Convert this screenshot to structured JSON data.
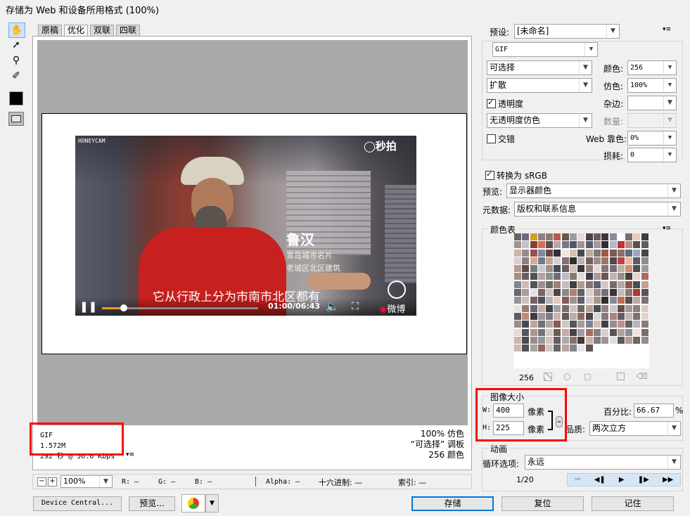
{
  "window": {
    "title": "存储为 Web 和设备所用格式 (100%)"
  },
  "tabs": [
    {
      "label": "原稿"
    },
    {
      "label": "优化"
    },
    {
      "label": "双联"
    },
    {
      "label": "四联"
    }
  ],
  "tools": [
    "hand-icon",
    "slice-select-icon",
    "zoom-icon",
    "eyedropper-icon",
    "eyedropper-color-swatch",
    "toggle-slices-icon"
  ],
  "video": {
    "watermark_left": "HONEYCAM",
    "watermark_right": "秒拍",
    "name": "鲁汉",
    "caption_small_1": "青岛城市名片",
    "caption_small_2": "老城区北区建筑",
    "subtitle": "它从行政上分为市南市北区都有",
    "time": "01:00/06:43",
    "weibo": "微博",
    "progress_fraction": 0.14
  },
  "info_left": {
    "format": "GIF",
    "size": "1.572M",
    "time": "292 秒 @ 56.6 Kbps"
  },
  "info_right": {
    "line1": "100% 仿色",
    "line2": "“可选择” 调板",
    "line3": "256 颜色"
  },
  "status_bar": {
    "zoom": "100%",
    "r_label": "R:",
    "r_val": "—",
    "g_label": "G:",
    "g_val": "—",
    "b_label": "B:",
    "b_val": "—",
    "alpha_label": "Alpha:",
    "alpha_val": "—",
    "hex_label": "十六进制:",
    "hex_val": "—",
    "index_label": "索引:",
    "index_val": "—"
  },
  "bottom_buttons": {
    "device_central": "Device Central...",
    "preview": "预览...",
    "save": "存储",
    "reset": "复位",
    "remember": "记住"
  },
  "settings": {
    "preset_label": "预设:",
    "preset_value": "[未命名]",
    "format": "GIF",
    "reduction": "可选择",
    "colors_label": "颜色:",
    "colors_value": "256",
    "dither_algo": "扩散",
    "dither_label": "仿色:",
    "dither_value": "100%",
    "transparency_label": "透明度",
    "transparency_checked": true,
    "matte_label": "杂边:",
    "matte_value": "",
    "trans_dither": "无透明度仿色",
    "amount_label": "数量:",
    "amount_value": "",
    "interlaced_label": "交错",
    "interlaced_checked": false,
    "websnap_label": "Web 靠色:",
    "websnap_value": "0%",
    "lossy_label": "损耗:",
    "lossy_value": "0",
    "srgb_label": "转换为 sRGB",
    "srgb_checked": true,
    "preview_label": "预览:",
    "preview_value": "显示器颜色",
    "metadata_label": "元数据:",
    "metadata_value": "版权和联系信息"
  },
  "color_table": {
    "title": "颜色表",
    "count": "256",
    "colors": [
      "#6b6366",
      "#6e6a7c",
      "#cfa028",
      "#8e7f84",
      "#8d7a7a",
      "#b85b4d",
      "#5f5a52",
      "#a29aa1",
      "#e6d9d6",
      "#494246",
      "#6e5b58",
      "#3a3a3c",
      "#8d8a9c",
      "#ffffff",
      "#7b6b6a",
      "#e8cdb9",
      "#3e3c3f",
      "#a1948a",
      "#c5c0c4",
      "#8a3f35",
      "#d96a55",
      "#5c4d4b",
      "#b5a8aa",
      "#757a86",
      "#4f5868",
      "#a69292",
      "#585a6f",
      "#a99799",
      "#2d2c34",
      "#b3b9c8",
      "#cc2f2f",
      "#b88f81",
      "#5a4f56",
      "#5a605a",
      "#c9b5a7",
      "#928e90",
      "#9a5048",
      "#7a8ca0",
      "#6e4944",
      "#323035",
      "#efe5e1",
      "#d8c0b0",
      "#49474f",
      "#bca9a0",
      "#7c7a74",
      "#a3564b",
      "#7b5950",
      "#8e6e66",
      "#5b6b86",
      "#a5a5b8",
      "#4c4444",
      "#d8cfd2",
      "#8c807c",
      "#e0a58f",
      "#6e7a92",
      "#c6a494",
      "#d4d0d4",
      "#8a6c75",
      "#2e2f2a",
      "#bfb3b5",
      "#6f625f",
      "#9f8d85",
      "#a07366",
      "#4c494b",
      "#c3403c",
      "#e9b8a0",
      "#5c5a62",
      "#8a8e8a",
      "#b49c93",
      "#5d4b46",
      "#767b7e",
      "#c9cbd0",
      "#a28d88",
      "#464b5a",
      "#6a5c5c",
      "#cfbfbd",
      "#3b3637",
      "#937e79",
      "#e3dadb",
      "#82747a",
      "#7c6b72",
      "#b7b1a8",
      "#cf8a78",
      "#4f4b50",
      "#9e9ba2",
      "#ad8b80",
      "#675d63",
      "#524f58",
      "#b3a2a4",
      "#8b928e",
      "#6f6d74",
      "#bebcbe",
      "#90766f",
      "#dedcd8",
      "#3a3d45",
      "#a99994",
      "#6c5651",
      "#c4b1aa",
      "#958d91",
      "#4b3a39",
      "#e7d6c7",
      "#b36a5d",
      "#7f888f",
      "#d0b8b2",
      "#55525c",
      "#9c8e93",
      "#6c6a65",
      "#a08077",
      "#c2bcc1",
      "#3f4040",
      "#b09a90",
      "#877472",
      "#596474",
      "#d6c7c1",
      "#786a6e",
      "#b1aaab",
      "#94554b",
      "#4a4c5a",
      "#c49e8f",
      "#68656b",
      "#a49ea3",
      "#e5e0e2",
      "#7e6360",
      "#cbc2c3",
      "#514646",
      "#8f888b",
      "#b4806f",
      "#5f6166",
      "#dbcfc7",
      "#a18c8c",
      "#706f7a",
      "#3a3434",
      "#c5b9b9",
      "#8d7770",
      "#aa3a32",
      "#5c5350",
      "#95949c",
      "#cfc1b8",
      "#746460",
      "#4b535f",
      "#b9b0b6",
      "#e0c9bd",
      "#835e58",
      "#9d9290",
      "#645f67",
      "#d2cccd",
      "#a7968e",
      "#2f2c2e",
      "#878b98",
      "#c06c5a",
      "#574e50",
      "#b5aaa5",
      "#7a7276",
      "#e8e3e3",
      "#9a7a72",
      "#5f6876",
      "#c8aca2",
      "#434346",
      "#a2a0a7",
      "#826b68",
      "#d3c0bc",
      "#6e6766",
      "#b99d93",
      "#4d4d55",
      "#95837f",
      "#c7c6cb",
      "#6a4d47",
      "#a59998",
      "#8b8081",
      "#dccbc5",
      "#5a5b60",
      "#bf8a7a",
      "#3d3c42",
      "#a09295",
      "#7a7d86",
      "#cdb4ab",
      "#65585a",
      "#b7aeb0",
      "#906a60",
      "#4a4648",
      "#d8d6d8",
      "#847878",
      "#a9847a",
      "#5e5e68",
      "#c3b6b1",
      "#797378",
      "#e3d3cc",
      "#9b8b88",
      "#484a51",
      "#bea497",
      "#6f6e73",
      "#b1a3a1",
      "#8a5a51",
      "#cdc5c7",
      "#5a5556",
      "#a99c9c",
      "#7b8494",
      "#d9bcad",
      "#3e3f47",
      "#978c8f",
      "#c2928a",
      "#686265",
      "#b8b4b8",
      "#8f7b76",
      "#e6dad6",
      "#55565e",
      "#ab9590",
      "#767378",
      "#d4c9c7",
      "#6a5b57",
      "#c1aba4",
      "#444248",
      "#9d9da5",
      "#a46b5e",
      "#847e84",
      "#d3cfd1",
      "#5e5356",
      "#b5a097",
      "#8a8d94",
      "#efe3de",
      "#73706f",
      "#c7b8b4",
      "#4c4a4f",
      "#a08a85",
      "#9095a0",
      "#d9c2b8",
      "#625c60",
      "#b0a7a9",
      "#88706c",
      "#3f3b3d",
      "#cab1a7",
      "#7d7b80",
      "#a5928d",
      "#e1dedf",
      "#575a63",
      "#bc988b",
      "#6c6669",
      "#98898b",
      "#cfbab3",
      "#4f4f57",
      "#aaa3a6",
      "#8d6660",
      "#d2c6c2",
      "#66646a",
      "#b7a49e",
      "#808590",
      "#e9e5e6",
      "#5a5253"
    ]
  },
  "image_size": {
    "title": "图像大小",
    "w_label": "W:",
    "w_value": "400",
    "w_unit": "像素",
    "h_label": "H:",
    "h_value": "225",
    "h_unit": "像素",
    "percent_label": "百分比:",
    "percent_value": "66.67",
    "percent_unit": "%",
    "quality_label": "品质:",
    "quality_value": "两次立方"
  },
  "animation": {
    "title": "动画",
    "loop_label": "循环选项:",
    "loop_value": "永远",
    "frame": "1/20"
  },
  "highlight_color": "#ff0000"
}
